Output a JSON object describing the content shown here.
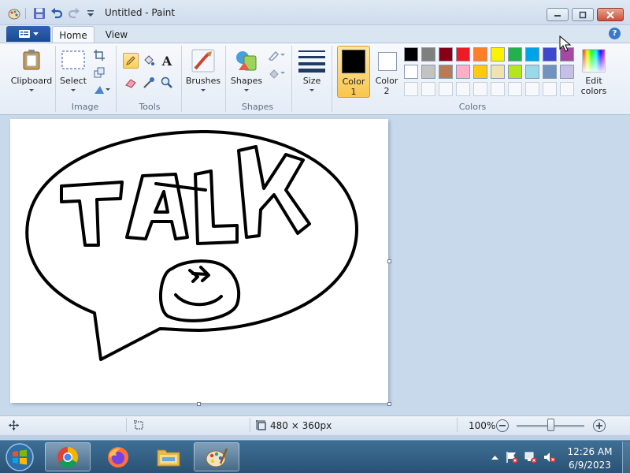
{
  "window": {
    "title": "Untitled - Paint",
    "quick_access": [
      "paint-app-icon",
      "save-icon",
      "undo-icon",
      "redo-icon",
      "customize-icon"
    ]
  },
  "ribbon": {
    "file_menu_icon": "menu-icon",
    "tabs": [
      {
        "label": "Home",
        "active": true
      },
      {
        "label": "View",
        "active": false
      }
    ],
    "groups": {
      "clipboard": {
        "button_label": "Clipboard"
      },
      "image": {
        "label": "Image",
        "select_label": "Select"
      },
      "tools": {
        "label": "Tools"
      },
      "brushes": {
        "label": "Brushes"
      },
      "shapes": {
        "label": "Shapes",
        "button_label": "Shapes"
      },
      "size": {
        "label": "Size"
      },
      "colors": {
        "label": "Colors",
        "color1_label": "Color",
        "color1_num": "1",
        "color2_label": "Color",
        "color2_num": "2",
        "edit_label": "Edit",
        "edit_label2": "colors",
        "color1": "#000000",
        "color2": "#ffffff",
        "palette_row1": [
          "#000000",
          "#7f7f7f",
          "#880015",
          "#ed1c24",
          "#ff7f27",
          "#fff200",
          "#22b14c",
          "#00a2e8",
          "#3f48cc",
          "#a349a4"
        ],
        "palette_row2": [
          "#ffffff",
          "#c3c3c3",
          "#b97a57",
          "#ffaec9",
          "#ffc90e",
          "#efe4b0",
          "#b5e61d",
          "#99d9ea",
          "#7092be",
          "#c8bfe7"
        ]
      }
    }
  },
  "canvas": {
    "drawing_text": "TALK"
  },
  "status": {
    "canvas_size": "480 × 360px",
    "zoom": "100%",
    "zoom_level": 0.5
  },
  "taskbar": {
    "apps": [
      "chrome-icon",
      "firefox-icon",
      "file-explorer-icon",
      "paint-icon"
    ],
    "time": "12:26 AM",
    "date": "6/9/2023"
  }
}
